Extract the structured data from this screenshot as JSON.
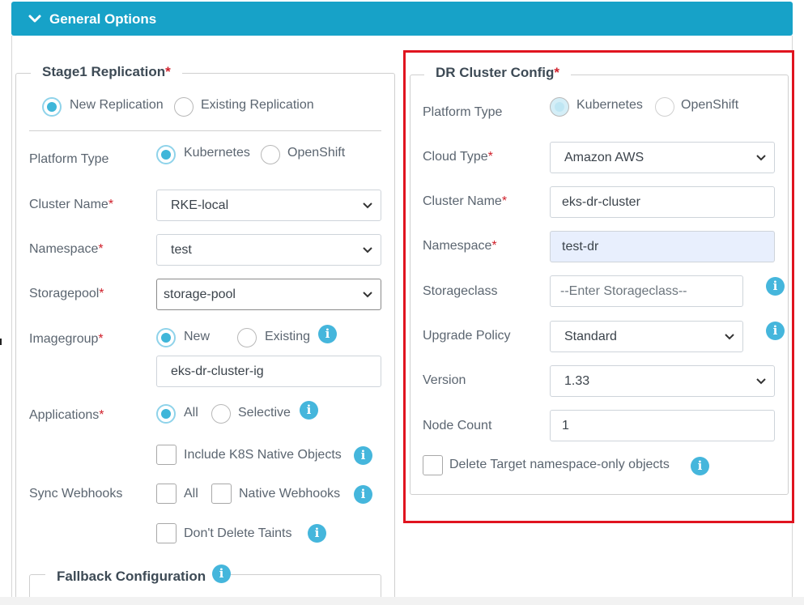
{
  "header": {
    "title": "General Options",
    "icon": "chevron-down-icon"
  },
  "stage1": {
    "title": "Stage1 Replication",
    "required": "*",
    "replication": {
      "new_label": "New Replication",
      "existing_label": "Existing Replication",
      "selected": "new"
    },
    "platform": {
      "label": "Platform Type",
      "k8s": "Kubernetes",
      "openshift": "OpenShift",
      "selected": "Kubernetes"
    },
    "cluster_name": {
      "label": "Cluster Name",
      "value": "RKE-local"
    },
    "namespace": {
      "label": "Namespace",
      "value": "test"
    },
    "storagepool": {
      "label": "Storagepool",
      "value": "storage-pool"
    },
    "imagegroup": {
      "label": "Imagegroup",
      "new": "New",
      "existing": "Existing",
      "selected": "New",
      "value": "eks-dr-cluster-ig"
    },
    "applications": {
      "label": "Applications",
      "all": "All",
      "selective": "Selective",
      "selected": "All",
      "include_k8s": "Include K8S Native Objects"
    },
    "sync_webhooks": {
      "label": "Sync Webhooks",
      "all": "All",
      "native": "Native Webhooks",
      "dont_delete_taints": "Don't Delete Taints"
    },
    "fallback": {
      "title": "Fallback Configuration"
    }
  },
  "dr": {
    "title": "DR Cluster Config",
    "required": "*",
    "platform": {
      "label": "Platform Type",
      "k8s": "Kubernetes",
      "openshift": "OpenShift",
      "selected": "Kubernetes"
    },
    "cloud_type": {
      "label": "Cloud Type",
      "value": "Amazon AWS"
    },
    "cluster_name": {
      "label": "Cluster Name",
      "value": "eks-dr-cluster"
    },
    "namespace": {
      "label": "Namespace",
      "value": "test-dr"
    },
    "storageclass": {
      "label": "Storageclass",
      "placeholder": "--Enter Storageclass--"
    },
    "upgrade_policy": {
      "label": "Upgrade Policy",
      "value": "Standard"
    },
    "version": {
      "label": "Version",
      "value": "1.33"
    },
    "node_count": {
      "label": "Node Count",
      "value": "1"
    },
    "delete_target": {
      "label": "Delete Target namespace-only objects"
    }
  },
  "colors": {
    "accent": "#17a2c8",
    "info": "#45b6dc",
    "highlight": "#e0141f",
    "required": "#d0212c"
  },
  "info_glyph": "i"
}
